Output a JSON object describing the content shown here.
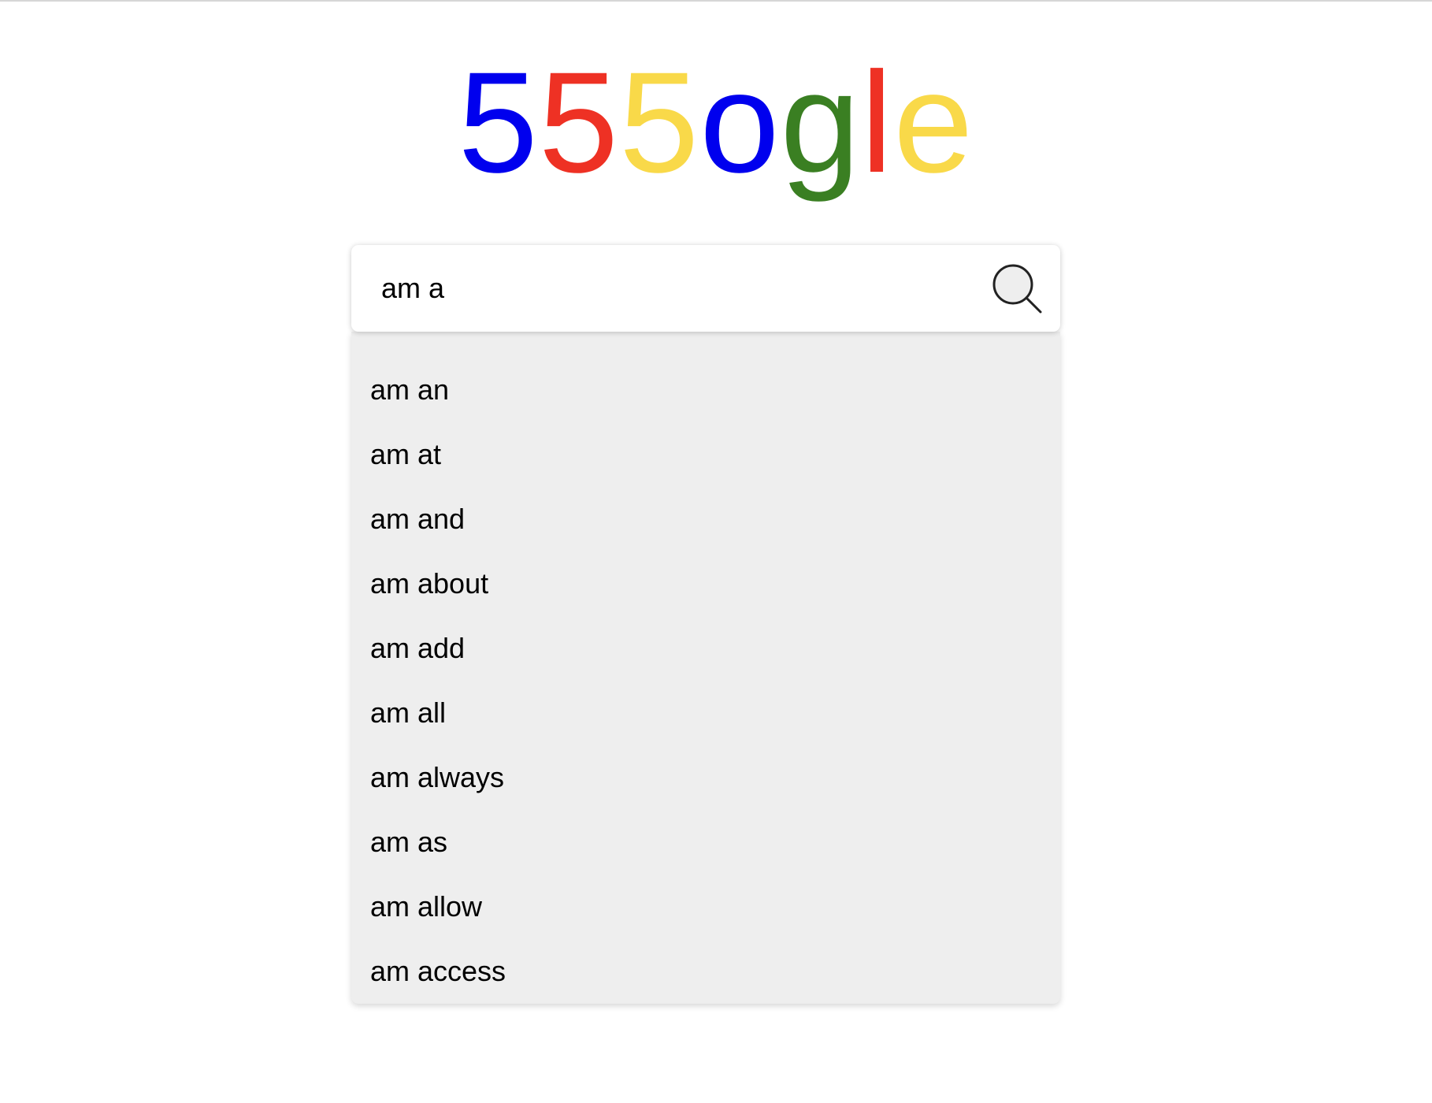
{
  "logo": {
    "letters": [
      {
        "char": "5",
        "color": "#0000ee"
      },
      {
        "char": "5",
        "color": "#ee3124"
      },
      {
        "char": "5",
        "color": "#f9d949"
      },
      {
        "char": "o",
        "color": "#0000ee"
      },
      {
        "char": "g",
        "color": "#3a7f22"
      },
      {
        "char": "l",
        "color": "#ee3124"
      },
      {
        "char": "e",
        "color": "#f9d949"
      }
    ]
  },
  "search": {
    "value": "am a",
    "icon": "search-icon"
  },
  "suggestions": [
    "am an",
    "am at",
    "am and",
    "am about",
    "am add",
    "am all",
    "am always",
    "am as",
    "am allow",
    "am access"
  ]
}
